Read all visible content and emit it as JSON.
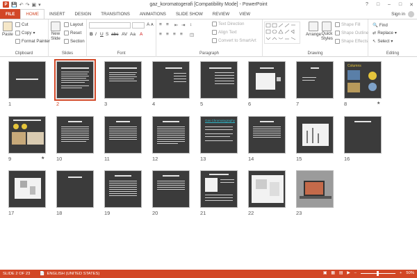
{
  "window": {
    "title": "gaz_koromatogerafi [Compatibility Mode] - PowerPoint",
    "app_icon": "P",
    "controls": [
      "?",
      "□",
      "–",
      "□",
      "✕"
    ]
  },
  "tabs": [
    "FILE",
    "HOME",
    "INSERT",
    "DESIGN",
    "TRANSITIONS",
    "ANIMATIONS",
    "SLIDE SHOW",
    "REVIEW",
    "VIEW"
  ],
  "active_tab": "HOME",
  "account": {
    "signin": "Sign in"
  },
  "ribbon": {
    "clipboard": {
      "label": "Clipboard",
      "paste": "Paste",
      "cut": "Cut",
      "copy": "Copy",
      "format_painter": "Format Painter"
    },
    "slides": {
      "label": "Slides",
      "new_slide": "New",
      "new_slide2": "Slide",
      "layout": "Layout",
      "reset": "Reset",
      "section": "Section"
    },
    "font": {
      "label": "Font"
    },
    "paragraph": {
      "label": "Paragraph",
      "text_direction": "Text Direction",
      "align_text": "Align Text",
      "convert_smartart": "Convert to SmartArt"
    },
    "drawing": {
      "label": "Drawing",
      "arrange": "Arrange",
      "quick_styles": "Quick",
      "quick_styles2": "Styles",
      "shape_fill": "Shape Fill",
      "shape_outline": "Shape Outline",
      "shape_effects": "Shape Effects"
    },
    "editing": {
      "label": "Editing",
      "find": "Find",
      "replace": "Replace",
      "select": "Select"
    }
  },
  "slides": [
    {
      "num": "1",
      "star": ""
    },
    {
      "num": "2",
      "star": ""
    },
    {
      "num": "3",
      "star": ""
    },
    {
      "num": "4",
      "star": ""
    },
    {
      "num": "5",
      "star": ""
    },
    {
      "num": "6",
      "star": ""
    },
    {
      "num": "7",
      "star": ""
    },
    {
      "num": "8",
      "star": "★"
    },
    {
      "num": "9",
      "star": "★"
    },
    {
      "num": "10",
      "star": ""
    },
    {
      "num": "11",
      "star": ""
    },
    {
      "num": "12",
      "star": ""
    },
    {
      "num": "13",
      "star": ""
    },
    {
      "num": "14",
      "star": ""
    },
    {
      "num": "15",
      "star": ""
    },
    {
      "num": "16",
      "star": ""
    },
    {
      "num": "17",
      "star": ""
    },
    {
      "num": "18",
      "star": ""
    },
    {
      "num": "19",
      "star": ""
    },
    {
      "num": "20",
      "star": ""
    },
    {
      "num": "21",
      "star": ""
    },
    {
      "num": "22",
      "star": ""
    },
    {
      "num": "23",
      "star": ""
    }
  ],
  "selected_slide": "2",
  "slide8_title": "Columns",
  "slide13_title": "Gas Chromatography",
  "status": {
    "slide_info": "SLIDE 2 OF 23",
    "language": "ENGLISH (UNITED STATES)",
    "zoom": "50%"
  },
  "colors": {
    "accent": "#d24726",
    "slide_bg": "#3b3b3b",
    "selection": "#d24726"
  }
}
